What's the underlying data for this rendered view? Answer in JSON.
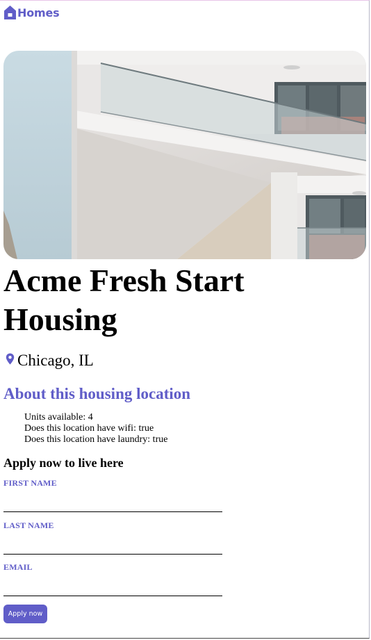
{
  "header": {
    "brand_label": "Homes",
    "brand_icon": "home-icon",
    "brand_color": "#605dc8"
  },
  "listing": {
    "photo_icon": "building-photo",
    "title": "Acme Fresh Start Housing",
    "location_icon": "map-pin-icon",
    "location": "Chicago, IL"
  },
  "about": {
    "heading": "About this housing location",
    "features": [
      "Units available: 4",
      "Does this location have wifi: true",
      "Does this location have laundry: true"
    ]
  },
  "application": {
    "heading": "Apply now to live here",
    "first_name_label": "FIRST NAME",
    "first_name_value": "",
    "last_name_label": "LAST NAME",
    "last_name_value": "",
    "email_label": "EMAIL",
    "email_value": "",
    "submit_label": "Apply now"
  }
}
